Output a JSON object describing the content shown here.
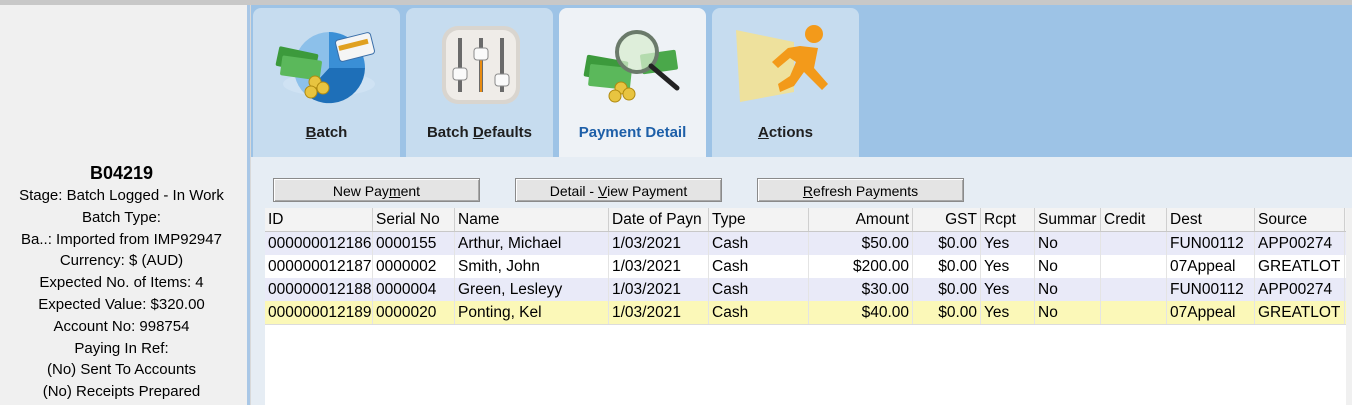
{
  "batch": {
    "id": "B04219",
    "lines": [
      "Stage: Batch Logged - In Work",
      "Batch Type:",
      "Ba..: Imported from IMP92947",
      "Currency: $ (AUD)",
      "Expected No. of Items: 4",
      "Expected Value: $320.00",
      "Account No: 998754",
      "Paying In Ref:",
      "(No) Sent To Accounts",
      "(No) Receipts Prepared"
    ]
  },
  "tabs": [
    {
      "pre": "",
      "mn": "B",
      "post": "atch",
      "icon": "batch-pie-chart-icon"
    },
    {
      "pre": "Batch ",
      "mn": "D",
      "post": "efaults",
      "icon": "sliders-icon"
    },
    {
      "pre": "Payment Detail",
      "mn": "",
      "post": "",
      "icon": "money-magnifier-icon",
      "active": true
    },
    {
      "pre": "",
      "mn": "A",
      "post": "ctions",
      "icon": "running-man-icon"
    }
  ],
  "buttons": {
    "new_payment": {
      "pre": "New Pay",
      "mn": "m",
      "post": "ent"
    },
    "detail_view": {
      "pre": "Detail - ",
      "mn": "V",
      "post": "iew Payment"
    },
    "refresh": {
      "pre": "",
      "mn": "R",
      "post": "efresh Payments"
    }
  },
  "grid": {
    "columns": [
      "ID",
      "Serial No",
      "Name",
      "Date of Payn",
      "Type",
      "Amount",
      "GST",
      "Rcpt",
      "Summar",
      "Credit",
      "Dest",
      "Source"
    ],
    "rows": [
      [
        "000000012186",
        "0000155",
        "Arthur, Michael",
        "1/03/2021",
        "Cash",
        "$50.00",
        "$0.00",
        "Yes",
        "No",
        "",
        "FUN00112",
        "APP00274"
      ],
      [
        "000000012187",
        "0000002",
        "Smith, John",
        "1/03/2021",
        "Cash",
        "$200.00",
        "$0.00",
        "Yes",
        "No",
        "",
        "07Appeal",
        "GREATLOT"
      ],
      [
        "000000012188",
        "0000004",
        "Green, Lesleyy",
        "1/03/2021",
        "Cash",
        "$30.00",
        "$0.00",
        "Yes",
        "No",
        "",
        "FUN00112",
        "APP00274"
      ],
      [
        "000000012189",
        "0000020",
        "Ponting, Kel",
        "1/03/2021",
        "Cash",
        "$40.00",
        "$0.00",
        "Yes",
        "No",
        "",
        "07Appeal",
        "GREATLOT"
      ]
    ],
    "selected_row": 3
  }
}
